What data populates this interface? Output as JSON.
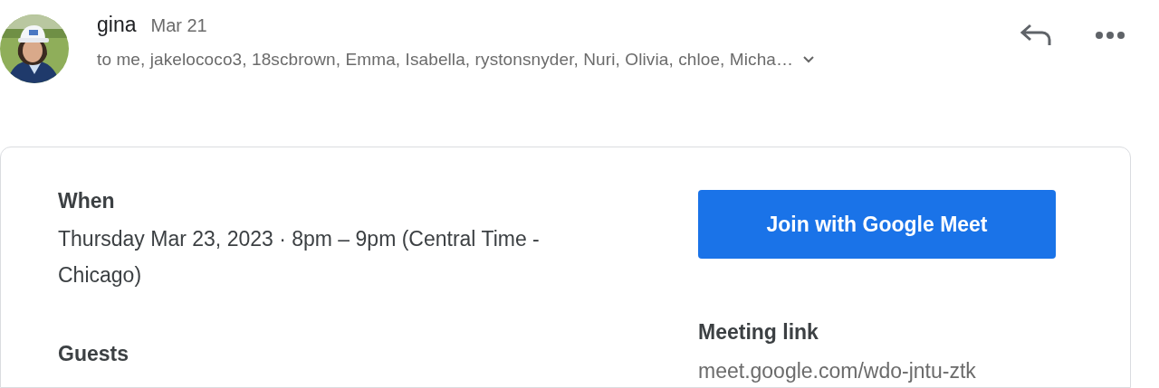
{
  "message": {
    "sender": "gina",
    "date": "Mar 21",
    "recipients": "to me, jakelococo3, 18scbrown, Emma, Isabella, rystonsnyder, Nuri, Olivia, chloe, Micha…"
  },
  "event": {
    "when_label": "When",
    "when": "Thursday Mar 23, 2023 · 8pm – 9pm (Central Time - Chicago)",
    "guests_label": "Guests",
    "join_button": "Join with Google Meet",
    "link_label": "Meeting link",
    "link": "meet.google.com/wdo-jntu-ztk"
  }
}
